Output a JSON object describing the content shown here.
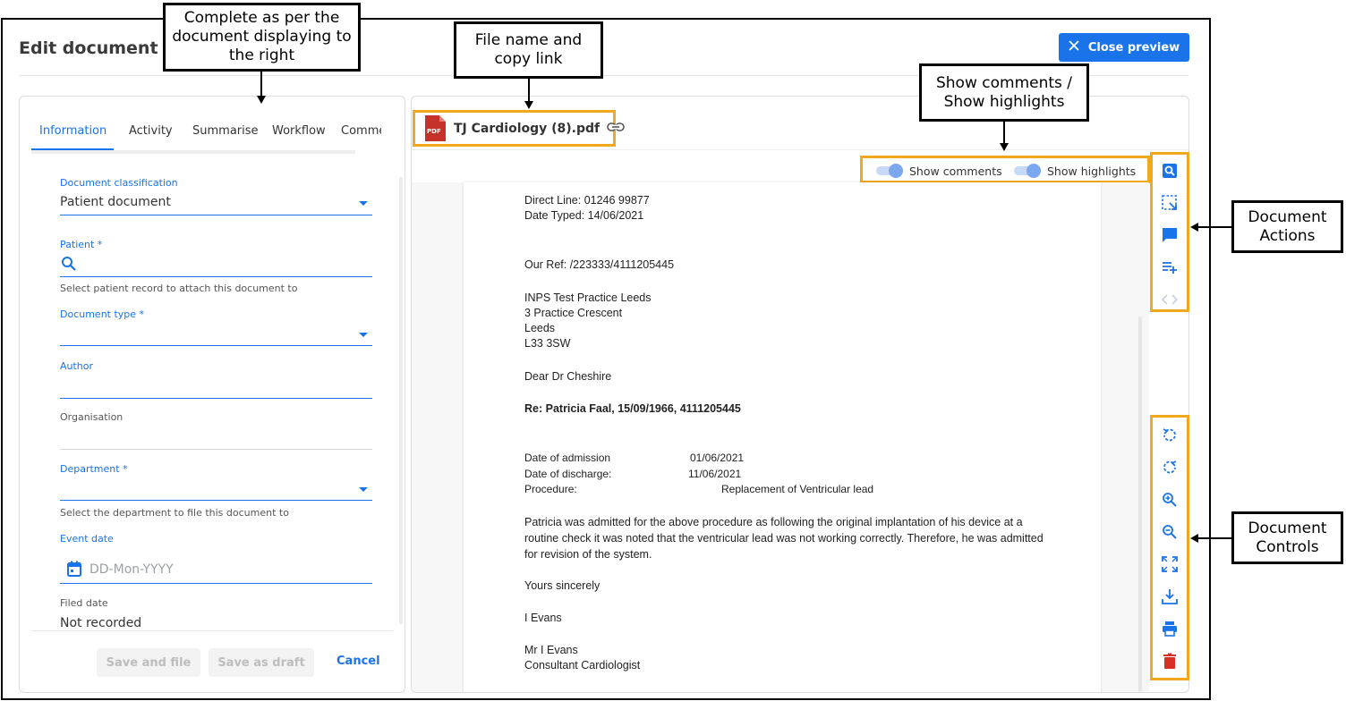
{
  "page": {
    "title": "Edit document"
  },
  "header": {
    "close_preview_label": "Close preview"
  },
  "tabs": [
    "Information",
    "Activity",
    "Summarise",
    "Workflow",
    "Comme"
  ],
  "form": {
    "classification": {
      "label": "Document classification",
      "value": "Patient document"
    },
    "patient": {
      "label": "Patient *",
      "helper": "Select patient record to attach this document to"
    },
    "document_type": {
      "label": "Document type *"
    },
    "author": {
      "label": "Author"
    },
    "organisation": {
      "label": "Organisation"
    },
    "department": {
      "label": "Department *",
      "helper": "Select the department to file this document to"
    },
    "event_date": {
      "label": "Event date",
      "placeholder": "DD-Mon-YYYY"
    },
    "filed_date": {
      "label": "Filed date",
      "value": "Not recorded"
    }
  },
  "footer": {
    "save_and_file": "Save and file",
    "save_as_draft": "Save as draft",
    "cancel": "Cancel"
  },
  "preview": {
    "pdf_badge": "PDF",
    "file_name": "TJ Cardiology (8).pdf",
    "show_comments": "Show comments",
    "show_highlights": "Show highlights"
  },
  "letter": {
    "direct_line": "Direct Line: 01246 99877",
    "date_typed": "Date Typed: 14/06/2021",
    "our_ref": "Our Ref: /223333/4111205445",
    "address": [
      "INPS Test Practice Leeds",
      "3 Practice Crescent",
      "Leeds",
      "L33 3SW"
    ],
    "salutation": "Dear Dr Cheshire",
    "re_line": "Re: Patricia Faal, 15/09/1966, 4111205445",
    "admission_label": "Date of admission",
    "admission_value": "01/06/2021",
    "discharge_label": "Date of discharge:",
    "discharge_value": "11/06/2021",
    "procedure_label": "Procedure:",
    "procedure_value": "Replacement of Ventricular lead",
    "body": "Patricia was admitted for the above procedure as following the original implantation of his device at a routine check it was noted that the ventricular lead was not working correctly. Therefore, he was admitted for revision of the system.",
    "closing": "Yours sincerely",
    "signature": "I Evans",
    "author_name": "Mr I Evans",
    "author_role": "Consultant Cardiologist"
  },
  "toolbar_actions": [
    "document-search-icon",
    "select-area-icon",
    "comment-icon",
    "add-summary-icon",
    "code-view-icon"
  ],
  "toolbar_controls": [
    "rotate-left-icon",
    "rotate-right-icon",
    "zoom-in-icon",
    "zoom-out-icon",
    "fit-screen-icon",
    "download-icon",
    "print-icon",
    "delete-icon"
  ],
  "callouts": {
    "complete": "Complete as per the document displaying to the right",
    "file_name": "File name and copy link",
    "show_toggles": "Show comments / Show highlights",
    "doc_actions": "Document Actions",
    "doc_controls": "Document Controls"
  },
  "colors": {
    "accent": "#1a73e8",
    "highlight_box": "#f0a81c",
    "delete": "#d93025",
    "pdf": "#c5322a"
  }
}
